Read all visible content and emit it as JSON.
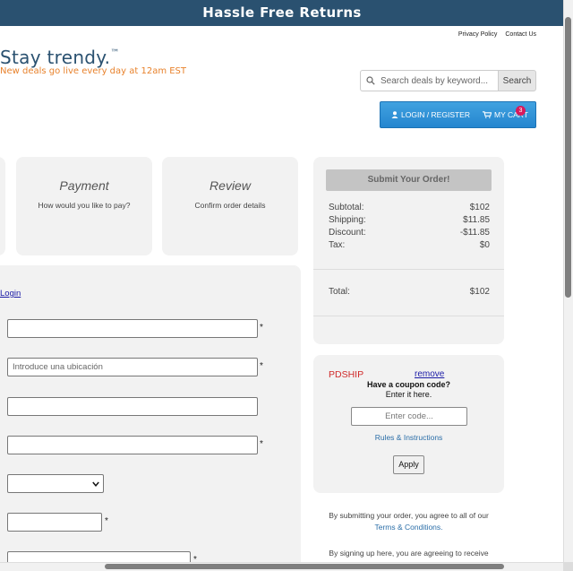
{
  "banner": {
    "text": "Hassle Free Returns"
  },
  "header_links": {
    "privacy": "Privacy Policy",
    "contact": "Contact Us"
  },
  "brand": {
    "name": "Stay trendy.",
    "tm": "™",
    "tagline": "New deals go live every day at 12am EST"
  },
  "search": {
    "placeholder": "Search deals by keyword...",
    "button": "Search"
  },
  "account": {
    "login_register": "LOGIN / REGISTER",
    "my_cart": "MY CART",
    "cart_count": "3"
  },
  "steps": [
    {
      "title": "Payment",
      "subtitle": "How would you like to pay?"
    },
    {
      "title": "Review",
      "subtitle": "Confirm order details"
    }
  ],
  "form": {
    "login_link": "Login",
    "location_placeholder": "Introduce una ubicación",
    "required_mark": "*"
  },
  "summary": {
    "submit_label": "Submit Your Order!",
    "rows": [
      {
        "label": "Subtotal:",
        "value": "$102"
      },
      {
        "label": "Shipping:",
        "value": "$11.85"
      },
      {
        "label": "Discount:",
        "value": "-$11.85"
      },
      {
        "label": "Tax:",
        "value": "$0"
      }
    ],
    "total_label": "Total:",
    "total_value": "$102"
  },
  "coupon": {
    "applied_code": "PDSHIP",
    "remove_label": "remove",
    "heading": "Have a coupon code?",
    "subheading": "Enter it here.",
    "input_placeholder": "Enter code...",
    "rules_link": "Rules & Instructions",
    "apply_label": "Apply"
  },
  "terms": {
    "text": "By submitting your order, you agree to all of our",
    "link": "Terms & Conditions.",
    "signup_text": "By signing up here, you are agreeing to receive"
  },
  "colors": {
    "banner": "#2a5170",
    "brand": "#2a5170",
    "tagline": "#e8822c",
    "account_button": "#2486cf",
    "cart_badge": "#d7195c",
    "promo_code": "#d02a2a"
  }
}
